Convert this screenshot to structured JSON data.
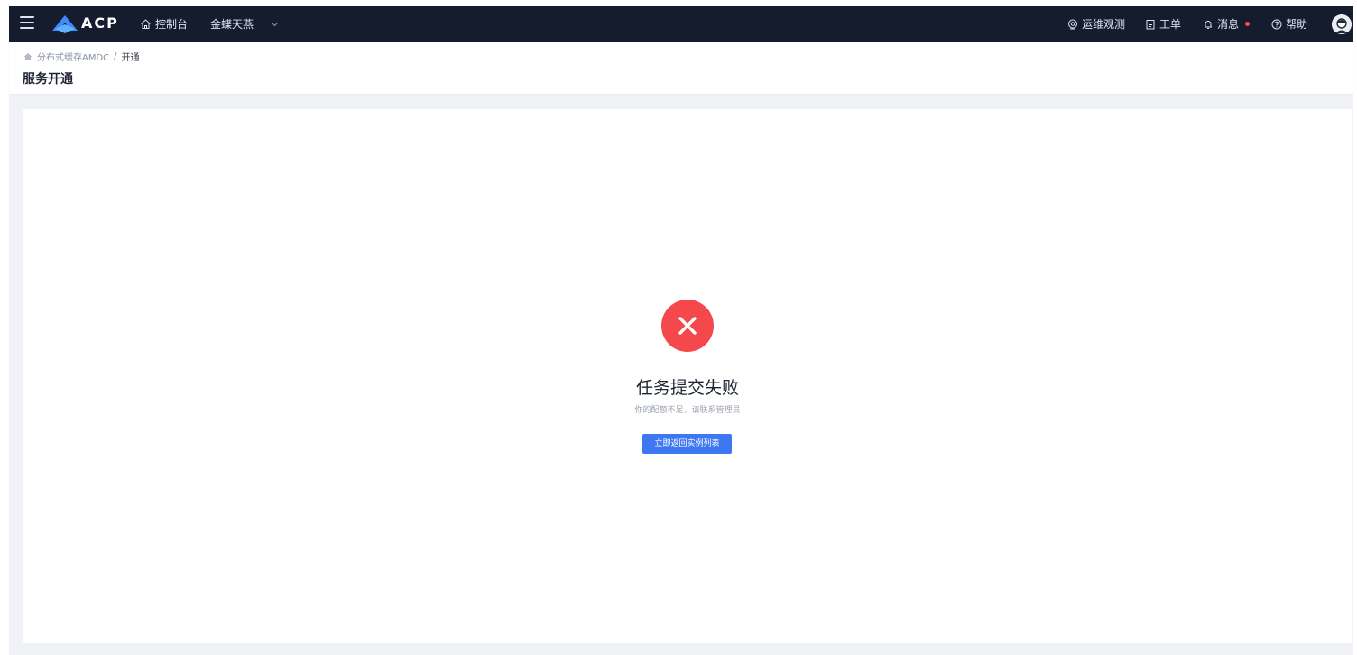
{
  "topbar": {
    "logo_text": "ACP",
    "console_label": "控制台",
    "tenant_label": "金蝶天燕",
    "ops_label": "运维观测",
    "ticket_label": "工单",
    "message_label": "消息",
    "help_label": "帮助"
  },
  "breadcrumb": {
    "parent": "分布式缓存AMDC",
    "separator": "/",
    "current": "开通"
  },
  "page": {
    "title": "服务开通"
  },
  "result": {
    "status": "error",
    "title": "任务提交失败",
    "subtitle": "你的配额不足，请联系管理员",
    "button_label": "立即返回实例列表"
  },
  "colors": {
    "topbar_bg": "#141c2e",
    "error": "#f5484c",
    "primary": "#3d78f2",
    "page_bg": "#f0f2f6"
  },
  "icons": [
    "menu-icon",
    "acp-logo-icon",
    "home-icon",
    "chevron-down-icon",
    "monitor-icon",
    "ticket-icon",
    "bell-icon",
    "help-icon",
    "avatar",
    "close-icon"
  ]
}
